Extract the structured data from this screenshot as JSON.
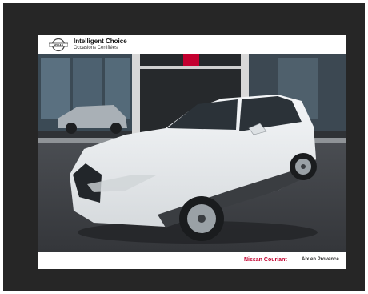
{
  "listing": {
    "brand_name": "Intelligent Choice",
    "brand_tagline": "Occasions Certifiées",
    "logo_text": "NISSAN",
    "dealer_name": "Nissan Couriant",
    "dealer_city": "Aix en Provence"
  },
  "colors": {
    "frame": "#262626",
    "dealer_accent": "#c3002f",
    "car_body": "#eceff1"
  },
  "icons": {
    "logo": "nissan-logo-icon"
  }
}
